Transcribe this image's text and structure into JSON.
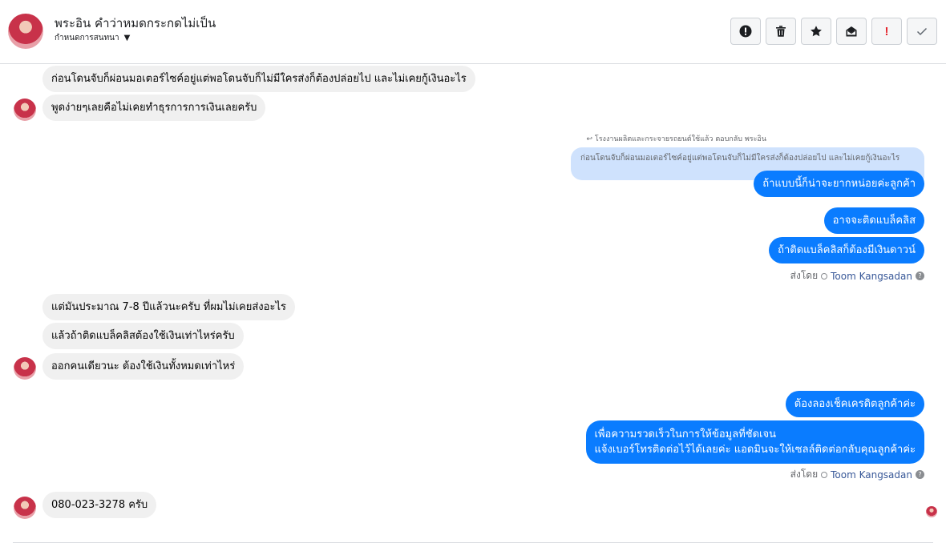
{
  "header": {
    "title": "พระอิน คำว่าหมดกระกดไม่เป็น",
    "subtitle": "กำหนดการสนทนา"
  },
  "actions": [
    {
      "icon": "alert-circle-icon"
    },
    {
      "icon": "trash-icon"
    },
    {
      "icon": "star-icon"
    },
    {
      "icon": "envelope-open-icon"
    },
    {
      "icon": "exclamation-icon",
      "label": "!"
    },
    {
      "icon": "check-icon"
    }
  ],
  "messages": {
    "m1": "ก่อนโดนจับก็ผ่อนมอเตอร์ไซค์อยู่แต่พอโดนจับก็ไม่มีใครส่งก็ต้องปล่อยไป และไม่เคยกู้เงินอะไร",
    "m2": "พูดง่ายๆเลยคือไม่เคยทำธุรการการเงินเลยครับ",
    "reply_meta": "โรงงานผลิตและกระจายรถยนต์ใช้แล้ว ตอบกลับ พระอิน",
    "reply_quote": "ก่อนโดนจับก็ผ่อนมอเตอร์ไซค์อยู่แต่พอโดนจับก็ไม่มีใครส่งก็ต้องปล่อยไป และไม่เคยกู้เงินอะไร",
    "o1": "ถ้าแบบนี้ก็น่าจะยากหน่อยค่ะลูกค้า",
    "o2": "อาจจะติดแบล็คลิส",
    "o3": "ถ้าติดแบล็คลิสก็ต้องมีเงินดาวน์",
    "sentby_label": "ส่งโดย",
    "sentby_name": "Toom Kangsadan",
    "m3": "แต่มันประมาณ 7-8 ปีแล้วนะครับ ที่ผมไม่เคยส่งอะไร",
    "m4": "แล้วถ้าติดแบล็คลิสต้องใช้เงินเท่าไหร่ครับ",
    "m5": "ออกคนเดียวนะ ต้องใช้เงินทั้งหมดเท่าไหร่",
    "o4": "ต้องลองเช็คเครดิตลูกค้าค่ะ",
    "o5_line1": "เพื่อความรวดเร็วในการให้ข้อมูลที่ชัดเจน",
    "o5_line2": "แจ้งเบอร์โทรติดต่อไว้ได้เลยค่ะ แอดมินจะให้เซลล์ติดต่อกลับคุณลูกค้าค่ะ",
    "m6": "080-023-3278 ครับ"
  }
}
